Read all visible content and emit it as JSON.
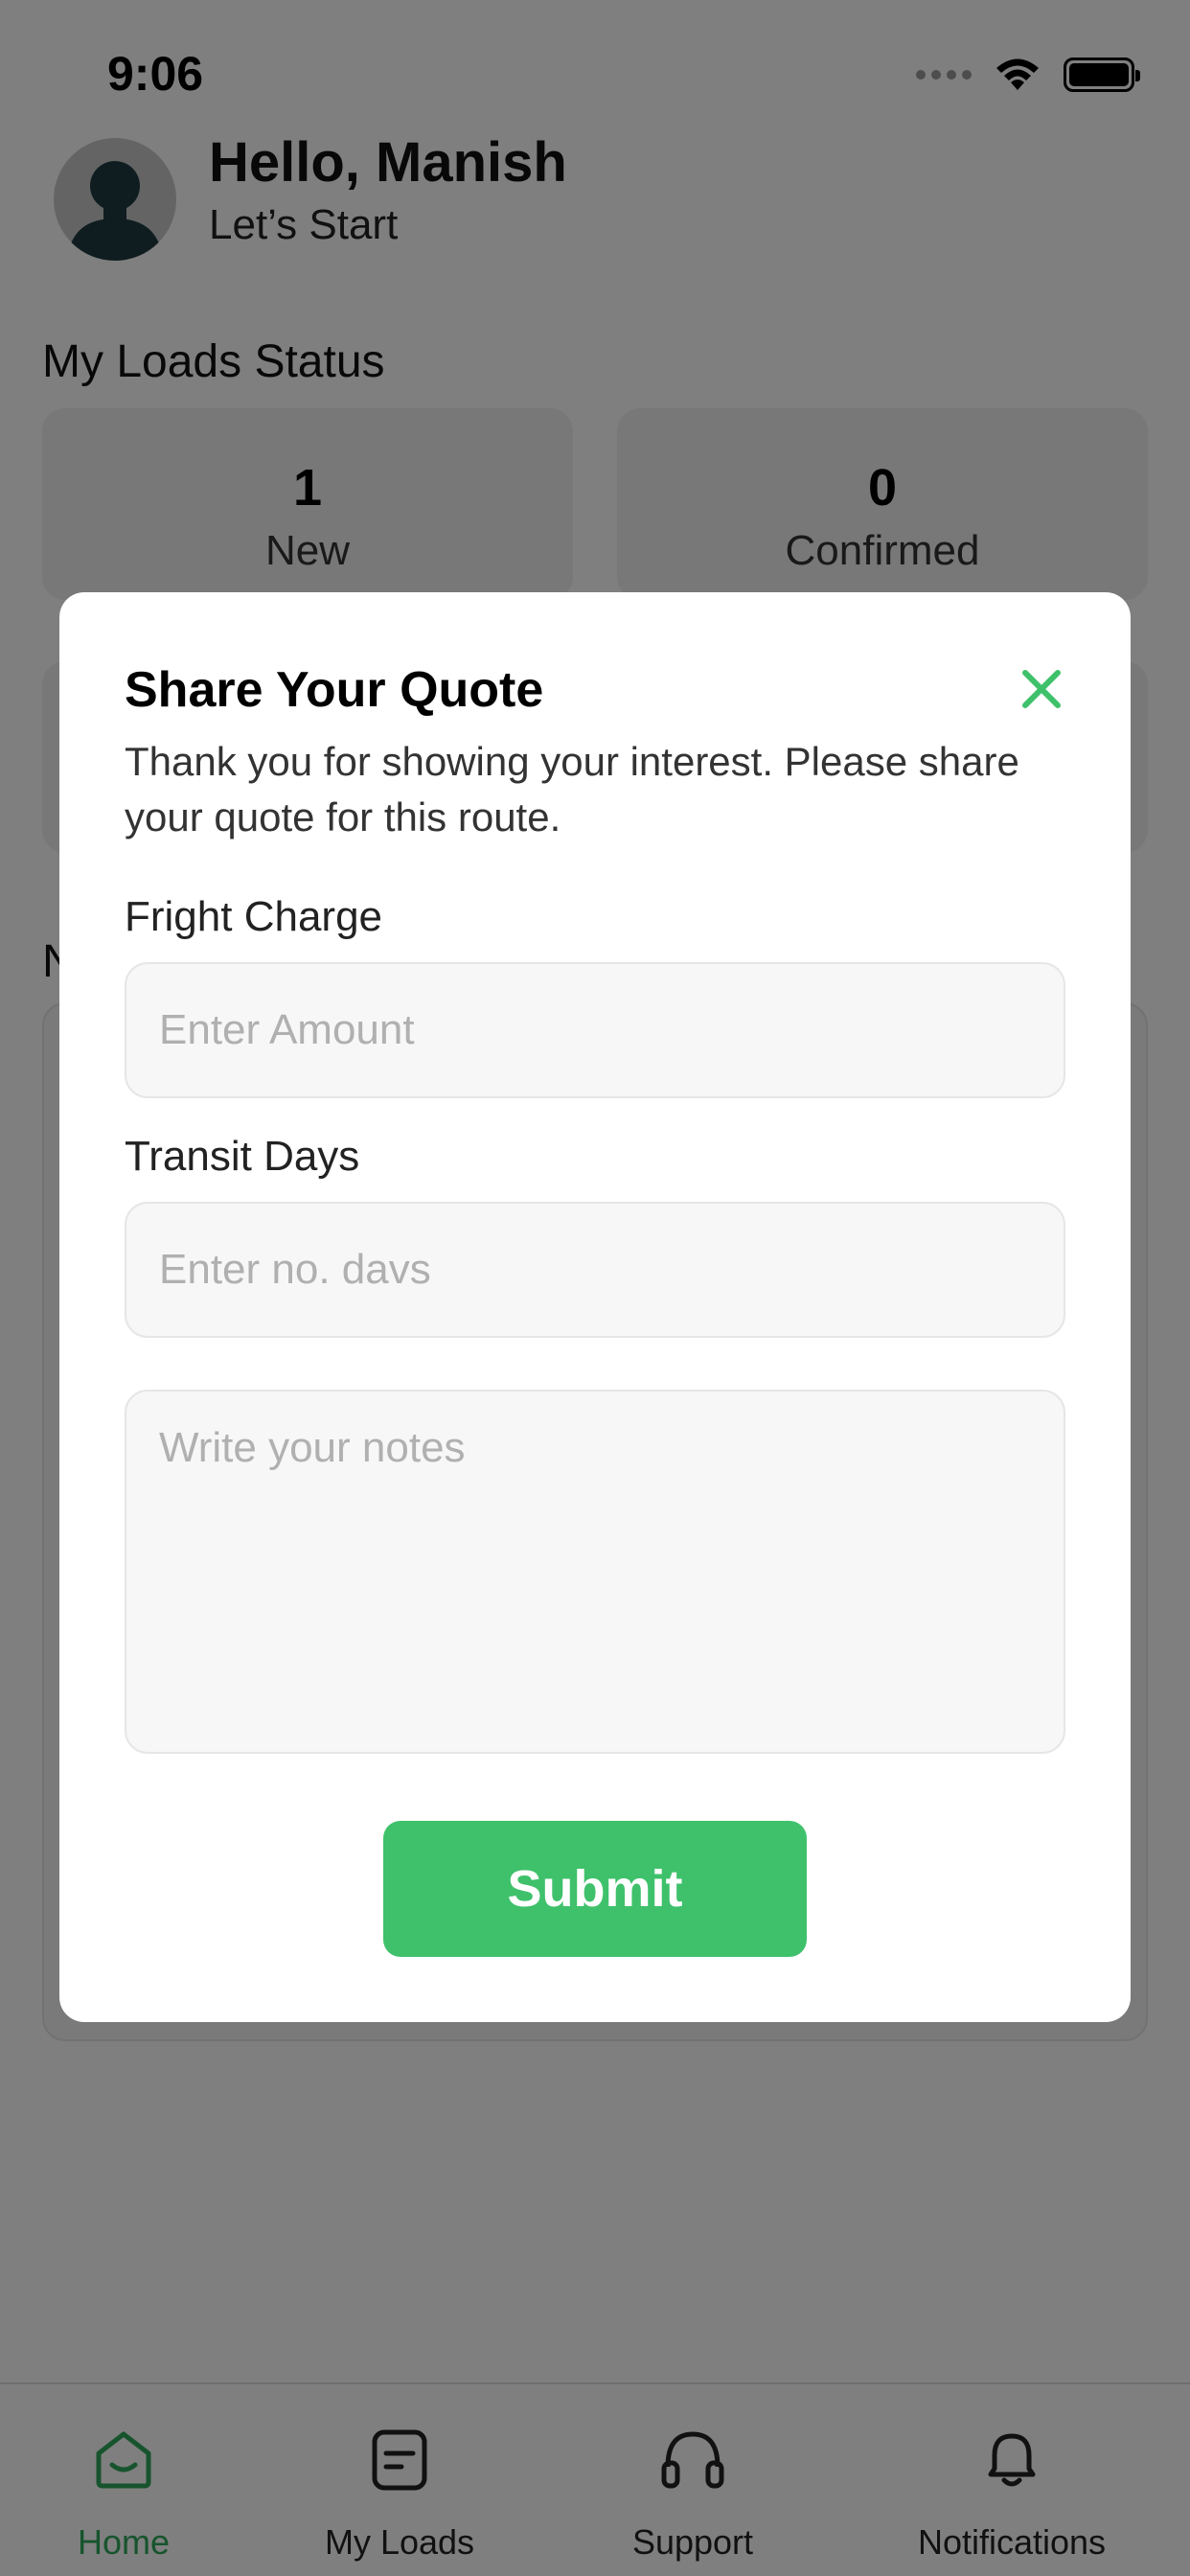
{
  "status_bar": {
    "time": "9:06",
    "icons": [
      "signal-dots-icon",
      "wifi-icon",
      "battery-icon"
    ]
  },
  "header": {
    "greeting": "Hello, Manish",
    "subtitle": "Let’s Start"
  },
  "loads_status": {
    "title": "My Loads Status",
    "cards": [
      {
        "count": "1",
        "label": "New"
      },
      {
        "count": "0",
        "label": "Confirmed"
      }
    ]
  },
  "new_loads": {
    "title_visible": "N"
  },
  "modal": {
    "title": "Share Your Quote",
    "description": "Thank you for showing your interest. Please share your quote for this route.",
    "fright_label": "Fright Charge",
    "fright_placeholder": "Enter Amount",
    "transit_label": "Transit Days",
    "transit_placeholder": "Enter no. davs",
    "notes_placeholder": "Write your notes",
    "submit_label": "Submit"
  },
  "bottom_nav": {
    "items": [
      {
        "label": "Home",
        "icon": "home-icon",
        "active": true
      },
      {
        "label": "My Loads",
        "icon": "document-icon",
        "active": false
      },
      {
        "label": "Support",
        "icon": "headset-icon",
        "active": false
      },
      {
        "label": "Notifications",
        "icon": "bell-icon",
        "active": false
      }
    ]
  },
  "colors": {
    "accent": "#3fc16b",
    "active_nav": "#2fa85a",
    "overlay": "rgba(0,0,0,0.5)"
  }
}
